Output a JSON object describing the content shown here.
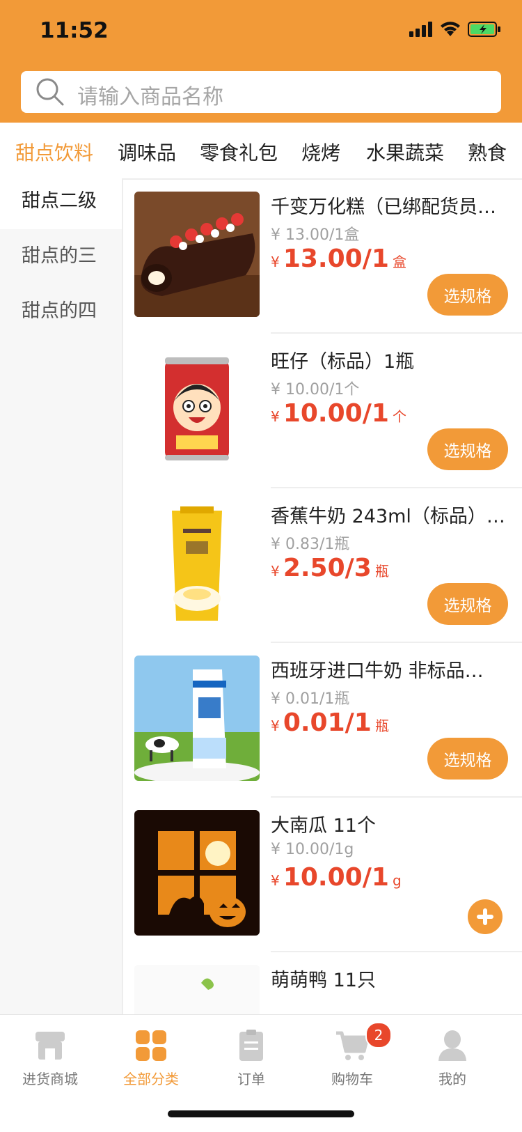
{
  "status": {
    "time": "11:52"
  },
  "search": {
    "placeholder": "请输入商品名称"
  },
  "categories": [
    {
      "label": "甜点饮料",
      "active": true
    },
    {
      "label": "调味品"
    },
    {
      "label": "零食礼包"
    },
    {
      "label": "烧烤"
    },
    {
      "label": "水果蔬菜"
    },
    {
      "label": "熟食"
    }
  ],
  "subcategories": [
    {
      "label": "甜点二级",
      "active": true
    },
    {
      "label": "甜点的三"
    },
    {
      "label": "甜点的四"
    }
  ],
  "products": [
    {
      "name": "千变万化糕（已绑配货员…",
      "orig": "¥ 13.00/1盒",
      "yen": "¥",
      "price": "13.00/1",
      "unit": "盒",
      "action": "选规格"
    },
    {
      "name": "旺仔（标品）1瓶",
      "orig": "¥ 10.00/1个",
      "yen": "¥",
      "price": "10.00/1",
      "unit": "个",
      "action": "选规格"
    },
    {
      "name": "香蕉牛奶 243ml（标品）…",
      "orig": "¥ 0.83/1瓶",
      "yen": "¥",
      "price": "2.50/3",
      "unit": "瓶",
      "action": "选规格"
    },
    {
      "name": "西班牙进口牛奶 非标品…",
      "orig": "¥ 0.01/1瓶",
      "yen": "¥",
      "price": "0.01/1",
      "unit": "瓶",
      "action": "选规格"
    },
    {
      "name": "大南瓜 11个",
      "orig": "¥ 10.00/1g",
      "yen": "¥",
      "price": "10.00/1",
      "unit": "g",
      "action": "+"
    },
    {
      "name": "萌萌鸭 11只"
    }
  ],
  "tabbar": [
    {
      "label": "进货商城",
      "icon": "store-icon"
    },
    {
      "label": "全部分类",
      "icon": "grid-icon",
      "active": true
    },
    {
      "label": "订单",
      "icon": "order-icon"
    },
    {
      "label": "购物车",
      "icon": "cart-icon",
      "badge": "2"
    },
    {
      "label": "我的",
      "icon": "user-icon"
    }
  ],
  "colors": {
    "accent": "#f29a38",
    "price": "#e8472b"
  }
}
